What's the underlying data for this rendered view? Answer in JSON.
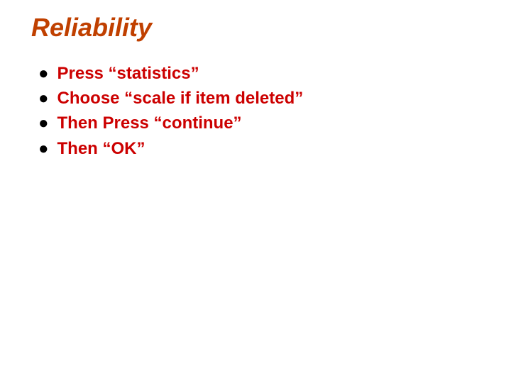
{
  "title": "Reliability",
  "bullets": [
    "Press “statistics”",
    "Choose “scale if item deleted”",
    "Then Press “continue”",
    "Then “OK”"
  ]
}
